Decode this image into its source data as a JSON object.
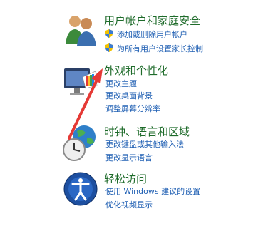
{
  "categories": [
    {
      "title": "用户帐户和家庭安全",
      "icon": "users-icon",
      "links": [
        "添加或删除用户帐户",
        "为所有用户设置家长控制"
      ]
    },
    {
      "title": "外观和个性化",
      "icon": "appearance-icon",
      "links": [
        "更改主题",
        "更改桌面背景",
        "调整屏幕分辨率"
      ]
    },
    {
      "title": "时钟、语言和区域",
      "icon": "clock-globe-icon",
      "links": [
        "更改键盘或其他输入法",
        "更改显示语言"
      ]
    },
    {
      "title": "轻松访问",
      "icon": "ease-of-access-icon",
      "links": [
        "使用 Windows 建议的设置",
        "优化视频显示"
      ]
    }
  ],
  "colors": {
    "title_green": "#1e6b2a",
    "link_blue": "#1f5fb3",
    "annotation_red": "#e53935"
  }
}
